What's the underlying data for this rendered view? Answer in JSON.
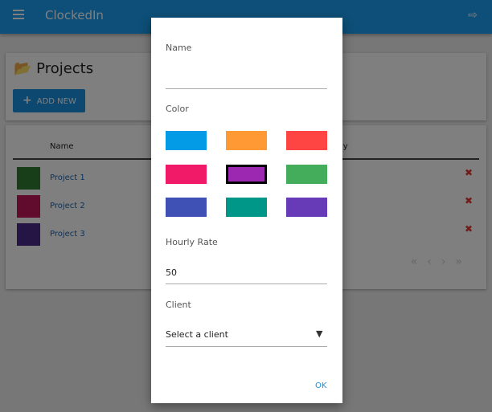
{
  "app": {
    "title": "ClockedIn",
    "menu_icon": "hamburger-icon",
    "logout_icon": "sign-out-icon"
  },
  "page": {
    "title": "Projects",
    "title_icon": "folder-open-icon",
    "add_label": "ADD NEW"
  },
  "table": {
    "headers": [
      "Name",
      "ly"
    ],
    "rows": [
      {
        "name": "Project 1",
        "color": "#2e7d32"
      },
      {
        "name": "Project 2",
        "color": "#c2185b"
      },
      {
        "name": "Project 3",
        "color": "#4a2a8a"
      }
    ],
    "pager": [
      "«",
      "‹",
      "›",
      "»"
    ]
  },
  "dialog": {
    "name_label": "Name",
    "name_value": "",
    "color_label": "Color",
    "colors": [
      "#039be5",
      "#ff9933",
      "#ff4444",
      "#f01a68",
      "#9c27b0",
      "#43ad5c",
      "#3f51b5",
      "#009688",
      "#673ab7"
    ],
    "selected_color": "#9c27b0",
    "rate_label": "Hourly Rate",
    "rate_value": "50",
    "client_label": "Client",
    "client_value": "Select a client",
    "ok_label": "OK"
  }
}
